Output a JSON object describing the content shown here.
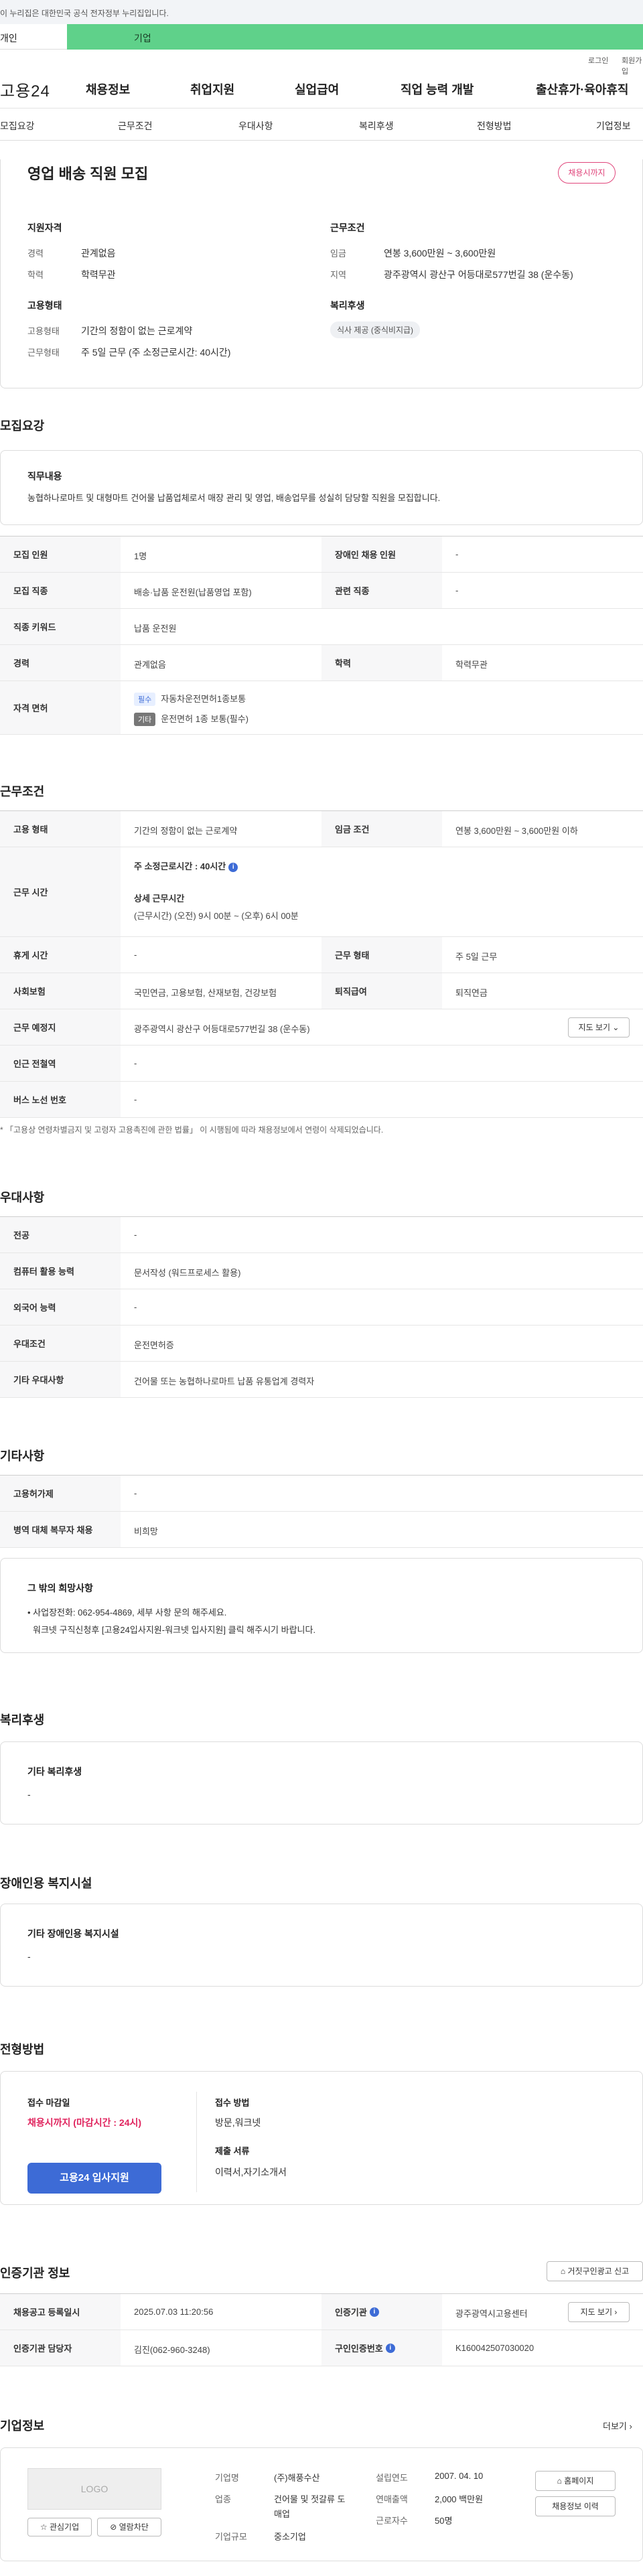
{
  "gov_banner": "이 누리집은 대한민국 공식 전자정부 누리집입니다.",
  "user_tabs": {
    "personal": "개인",
    "company": "기업"
  },
  "util": {
    "login": "로그인",
    "signup": "회원가입"
  },
  "logo": "고용24",
  "gnb": [
    "채용정보",
    "취업지원",
    "실업급여",
    "직업 능력 개발",
    "출산휴가·육아휴직"
  ],
  "anchors": [
    "모집요강",
    "근무조건",
    "우대사항",
    "복리후생",
    "전형방법",
    "기업정보"
  ],
  "summary": {
    "title": "영업 배송 직원 모집",
    "status_badge": "채용시까지",
    "qual_heading": "지원자격",
    "career_k": "경력",
    "career_v": "관계없음",
    "edu_k": "학력",
    "edu_v": "학력무관",
    "cond_heading": "근무조건",
    "wage_k": "임금",
    "wage_v": "연봉 3,600만원 ~ 3,600만원",
    "region_k": "지역",
    "region_v": "광주광역시 광산구 어등대로577번길 38 (운수동)",
    "emp_heading": "고용형태",
    "emptype_k": "고용형태",
    "emptype_v": "기간의 정함이 없는 근로계약",
    "workform_k": "근무형태",
    "workform_v": "주 5일 근무 (주 소정근로시간: 40시간)",
    "welfare_heading": "복리후생",
    "welfare_chip": "식사 제공 (중식비지급)"
  },
  "recruit": {
    "title": "모집요강",
    "duty_heading": "직무내용",
    "duty_text": "농협하나로마트 및 대형마트 건어물 납품업체로서 매장 관리 및 영업, 배송업무를 성실히 담당할 직원을 모집합니다.",
    "rows": {
      "count_k": "모집 인원",
      "count_v": "1명",
      "disabled_k": "장애인 채용 인원",
      "disabled_v": "-",
      "job_k": "모집 직종",
      "job_v": "배송·납품 운전원(납품영업 포함)",
      "related_k": "관련 직종",
      "related_v": "-",
      "keyword_k": "직종 키워드",
      "keyword_v": "납품 운전원",
      "career_k": "경력",
      "career_v": "관계없음",
      "edu_k": "학력",
      "edu_v": "학력무관",
      "license_k": "자격 면허",
      "license_req_tag": "필수",
      "license_req_v": "자동차운전면허1종보통",
      "license_opt_tag": "기타",
      "license_opt_v": "운전면허 1종 보통(필수)"
    }
  },
  "conditions": {
    "title": "근무조건",
    "emptype_k": "고용 형태",
    "emptype_v": "기간의 정함이 없는 근로계약",
    "wage_k": "임금 조건",
    "wage_v": "연봉 3,600만원 ~ 3,600만원 이하",
    "hours_k": "근무 시간",
    "hours_weekly": "주 소정근로시간 : 40시간",
    "hours_detail_h": "상세 근무시간",
    "hours_detail_v": "(근무시간) (오전) 9시 00분 ~ (오후) 6시 00분",
    "break_k": "휴게 시간",
    "break_v": "-",
    "workform_k": "근무 형태",
    "workform_v": "주 5일 근무",
    "insurance_k": "사회보험",
    "insurance_v": "국민연금, 고용보험, 산재보험, 건강보험",
    "severance_k": "퇴직급여",
    "severance_v": "퇴직연금",
    "place_k": "근무 예정지",
    "place_v": "광주광역시 광산구 어등대로577번길 38 (운수동)",
    "map_btn": "지도 보기",
    "subway_k": "인근 전철역",
    "subway_v": "-",
    "bus_k": "버스 노선 번호",
    "bus_v": "-",
    "note": "* 「고용상 연령차별금지 및 고령자 고용촉진에 관한 법률」 이 시행됨에 따라 채용정보에서 연령이 삭제되었습니다."
  },
  "preference": {
    "title": "우대사항",
    "major_k": "전공",
    "major_v": "-",
    "computer_k": "컴퓨터 활용 능력",
    "computer_v": "문서작성 (워드프로세스 활용)",
    "language_k": "외국어 능력",
    "language_v": "-",
    "cond_k": "우대조건",
    "cond_v": "운전면허증",
    "other_k": "기타 우대사항",
    "other_v": "건어물 또는 농협하나로마트 납품 유통업계 경력자"
  },
  "other": {
    "title": "기타사항",
    "facility_k": "고용허가제",
    "facility_v": "-",
    "military_k": "병역 대체 복무자 채용",
    "military_v": "비희망",
    "wish_heading": "그 밖의 희망사항",
    "wish_line1": "• 사업장전화: 062-954-4869, 세부 사항 문의 해주세요.",
    "wish_line2": "워크넷 구직신청후 [고용24입사지원-워크넷 입사지원] 클릭 해주시기 바랍니다."
  },
  "welfare": {
    "title": "복리후생",
    "heading": "기타 복리후생",
    "value": "-"
  },
  "disability": {
    "title": "장애인용 복지시설",
    "heading": "기타 장애인용 복지시설",
    "value": "-"
  },
  "selection": {
    "title": "전형방법",
    "deadline_h": "접수 마감일",
    "deadline_v": "채용시까지 (마감시간 : 24시)",
    "apply_btn": "고용24 입사지원",
    "method_h": "접수 방법",
    "method_v": "방문,워크넷",
    "docs_h": "제출 서류",
    "docs_v": "이력서,자기소개서"
  },
  "agency": {
    "title": "인증기관 정보",
    "report_btn": "거짓구인광고 신고",
    "reg_k": "채용공고 등록일시",
    "reg_v": "2025.07.03 11:20:56",
    "agency_k": "인증기관",
    "agency_v": "광주광역시고용센터",
    "map_btn": "지도 보기",
    "manager_k": "인증기관 담당자",
    "manager_v": "김진(062-960-3248)",
    "reqno_k": "구인인증번호",
    "reqno_v": "K160042507030020"
  },
  "company": {
    "title": "기업정보",
    "more": "더보기",
    "logo_text": "LOGO",
    "interest_btn": "관심기업",
    "block_btn": "열람차단",
    "name_k": "기업명",
    "name_v": "(주)해풍수산",
    "industry_k": "업종",
    "industry_v": "건어물 및 젓갈류 도매업",
    "size_k": "기업규모",
    "size_v": "중소기업",
    "founded_k": "설립연도",
    "founded_v": "2007. 04. 10",
    "revenue_k": "연매출액",
    "revenue_v": "2,000 백만원",
    "employees_k": "근로자수",
    "employees_v": "50명",
    "homepage_btn": "홈페이지",
    "jobs_btn": "채용정보 이력"
  }
}
